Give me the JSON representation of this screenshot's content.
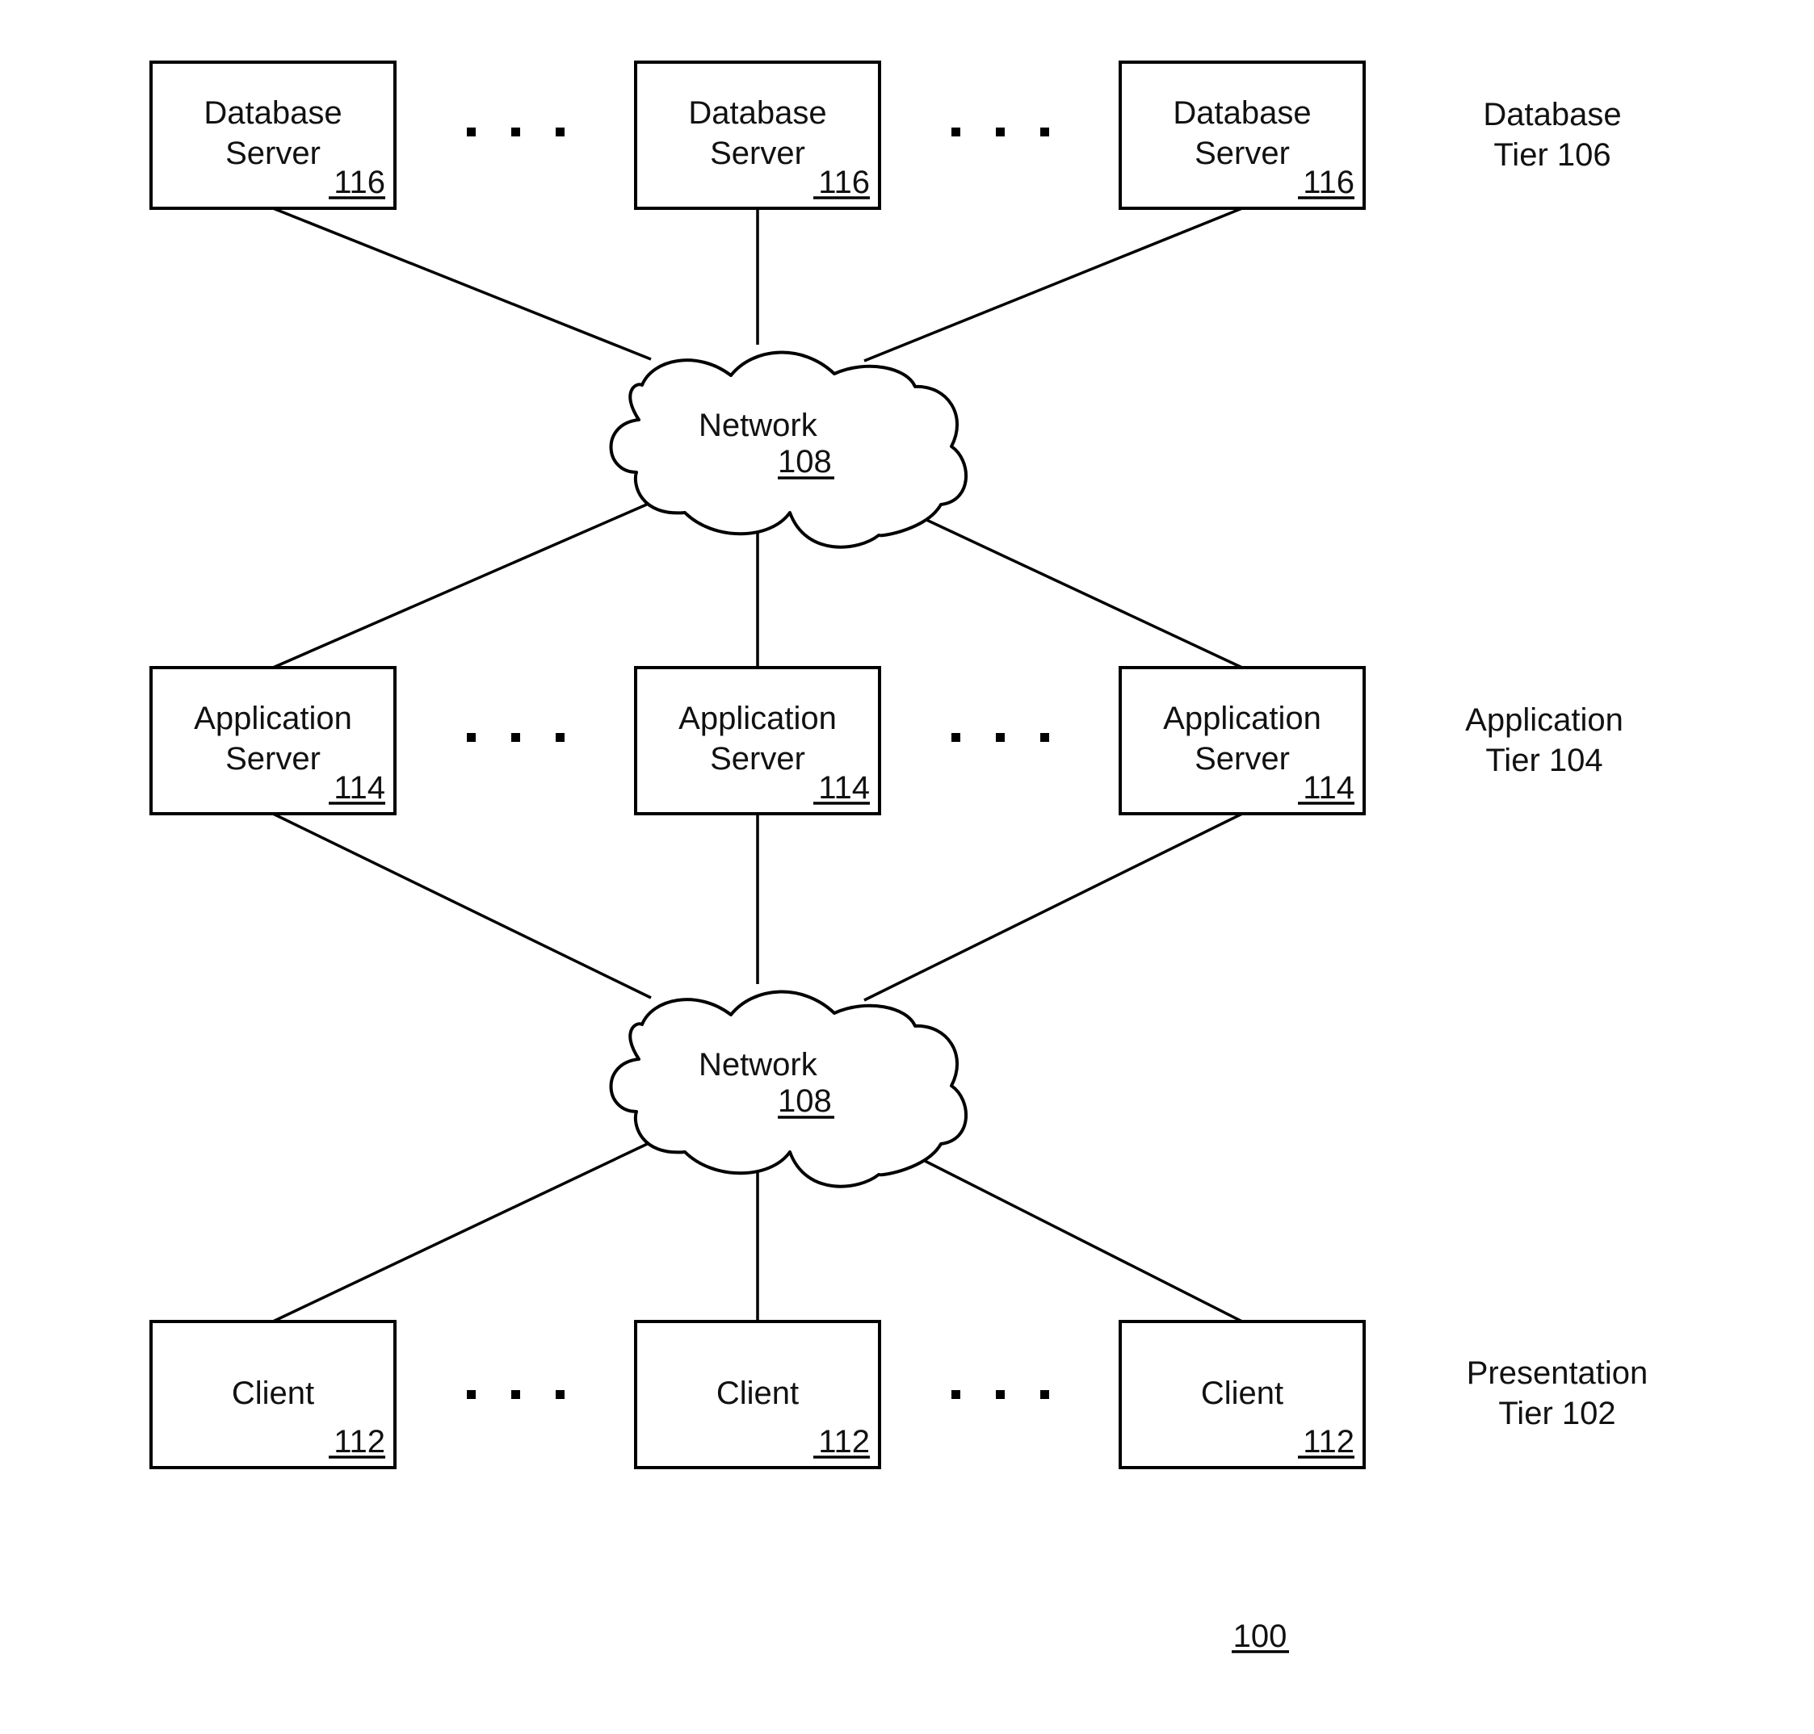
{
  "figure": {
    "reference_number": "100",
    "colors": {
      "stroke": "#000000",
      "background": "#ffffff",
      "text": "#111111"
    }
  },
  "tiers": [
    {
      "key": "database",
      "label_line1": "Database",
      "label_line2": "Tier 106",
      "nodes": [
        {
          "line1": "Database",
          "line2": "Server",
          "ref": "116"
        },
        {
          "line1": "Database",
          "line2": "Server",
          "ref": "116"
        },
        {
          "line1": "Database",
          "line2": "Server",
          "ref": "116"
        }
      ]
    },
    {
      "key": "application",
      "label_line1": "Application",
      "label_line2": "Tier 104",
      "nodes": [
        {
          "line1": "Application",
          "line2": "Server",
          "ref": "114"
        },
        {
          "line1": "Application",
          "line2": "Server",
          "ref": "114"
        },
        {
          "line1": "Application",
          "line2": "Server",
          "ref": "114"
        }
      ]
    },
    {
      "key": "presentation",
      "label_line1": "Presentation",
      "label_line2": "Tier 102",
      "nodes": [
        {
          "line1": "Client",
          "ref": "112"
        },
        {
          "line1": "Client",
          "ref": "112"
        },
        {
          "line1": "Client",
          "ref": "112"
        }
      ]
    }
  ],
  "networks": [
    {
      "label": "Network",
      "ref": "108",
      "connects": [
        "database",
        "application"
      ]
    },
    {
      "label": "Network",
      "ref": "108",
      "connects": [
        "application",
        "presentation"
      ]
    }
  ],
  "ellipsis": "..."
}
